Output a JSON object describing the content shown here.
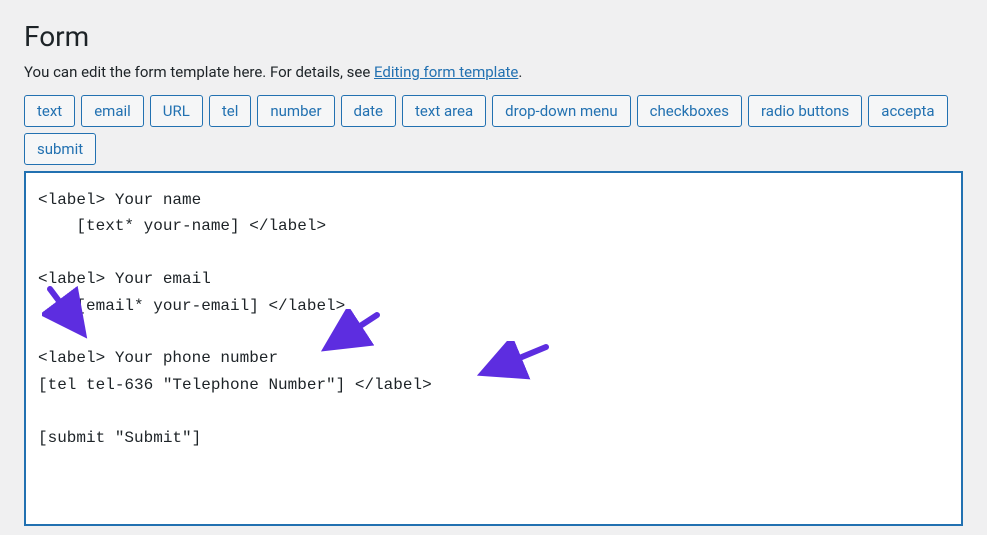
{
  "heading": "Form",
  "description": {
    "prefix": "You can edit the form template here. For details, see ",
    "link": "Editing form template",
    "suffix": "."
  },
  "tags": [
    "text",
    "email",
    "URL",
    "tel",
    "number",
    "date",
    "text area",
    "drop-down menu",
    "checkboxes",
    "radio buttons",
    "accepta"
  ],
  "tags_row2": [
    "submit"
  ],
  "editor_content": "<label> Your name\n    [text* your-name] </label>\n\n<label> Your email\n    [email* your-email] </label>\n\n<label> Your phone number\n[tel tel-636 \"Telephone Number\"] </label>\n\n[submit \"Submit\"]",
  "annotation": {
    "arrow_color": "#5d2de0"
  }
}
